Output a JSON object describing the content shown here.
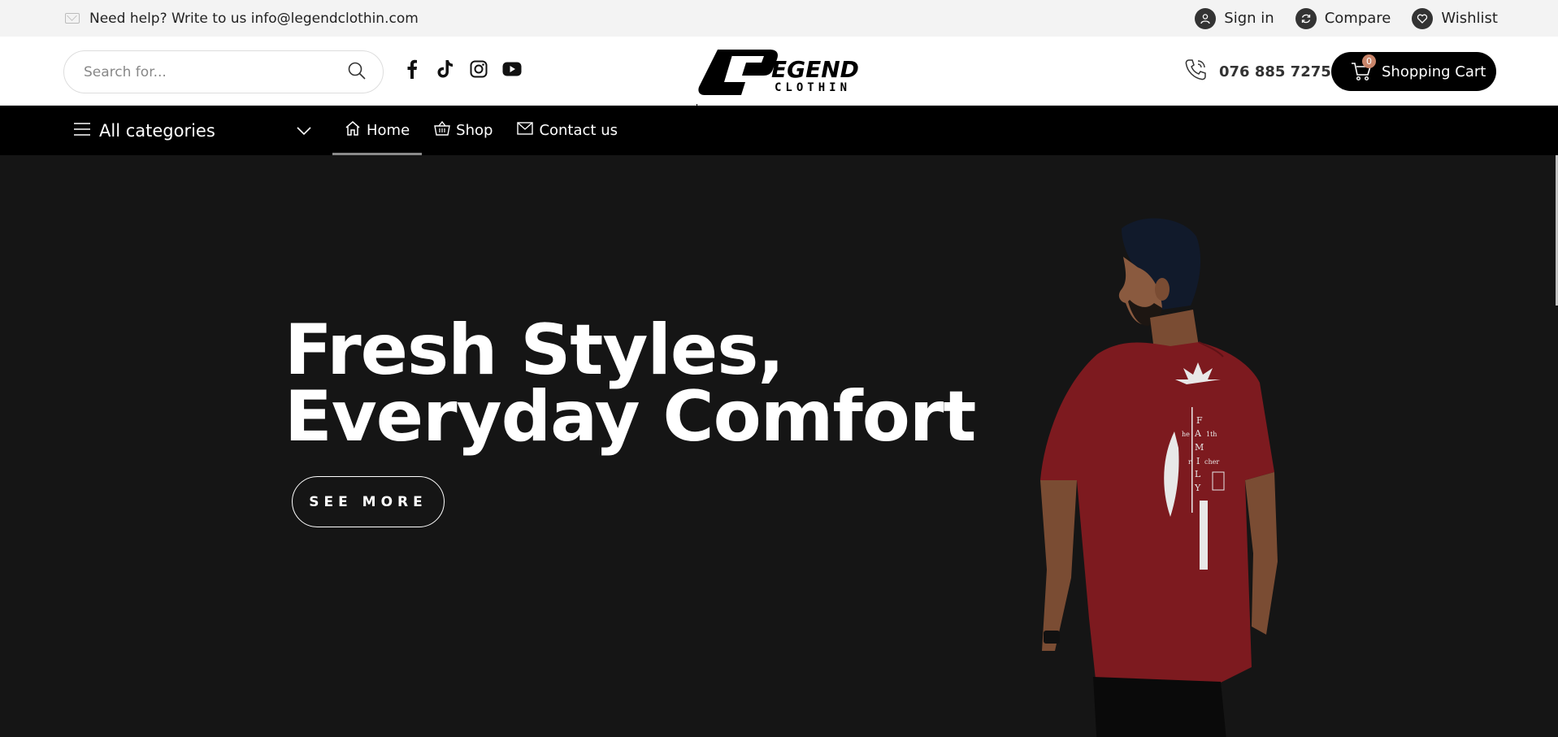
{
  "topbar": {
    "help_text": "Need help? Write to us info@legendclothin.com",
    "sign_in": "Sign in",
    "compare": "Compare",
    "wishlist": "Wishlist"
  },
  "header": {
    "search_placeholder": "Search for...",
    "socials": [
      "facebook-icon",
      "tiktok-icon",
      "instagram-icon",
      "youtube-icon"
    ],
    "logo_text_top": "EGEND",
    "logo_text_bottom": "CLOTHIN",
    "phone": "076 885 7275",
    "cart_label": "Shopping Cart",
    "cart_count": "0"
  },
  "nav": {
    "all_categories": "All categories",
    "items": [
      {
        "label": "Home",
        "icon": "home-icon",
        "active": true
      },
      {
        "label": "Shop",
        "icon": "basket-icon",
        "active": false
      },
      {
        "label": "Contact us",
        "icon": "mail-icon",
        "active": false
      }
    ]
  },
  "hero": {
    "line1": "Fresh Styles,",
    "line2": "Everyday Comfort",
    "button": "SEE MORE",
    "shirt_print": [
      "F",
      "he",
      "A",
      "1th",
      "M",
      "r",
      "I",
      "cher",
      "L",
      "Y"
    ]
  },
  "colors": {
    "nav_bg": "#000000",
    "hero_bg": "#151515",
    "topbar_bg": "#f3f3f3",
    "badge": "#c9856a",
    "shirt": "#7d1a1f"
  }
}
